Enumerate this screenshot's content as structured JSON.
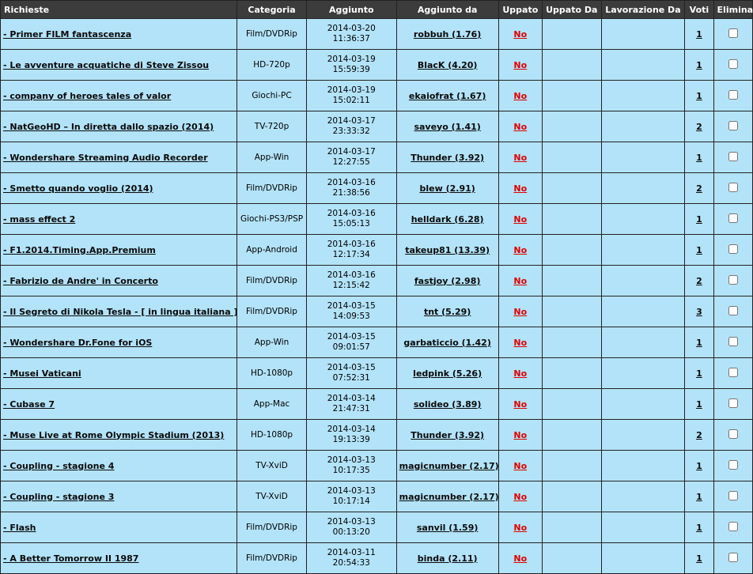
{
  "headers": [
    "Richieste",
    "Categoria",
    "Aggiunto",
    "Aggiunto da",
    "Uppato",
    "Uppato Da",
    "Lavorazione Da",
    "Voti",
    "Elimina"
  ],
  "rows": [
    {
      "title": "- Primer FILM fantascenza",
      "category": "Film/DVDRip",
      "date": "2014-03-20",
      "time": "11:36:37",
      "user": "robbuh (1.76)",
      "uppato": "No",
      "votes": "1"
    },
    {
      "title": "- Le avventure acquatiche di Steve Zissou",
      "category": "HD-720p",
      "date": "2014-03-19",
      "time": "15:59:39",
      "user": "BlacK (4.20)",
      "uppato": "No",
      "votes": "1"
    },
    {
      "title": "- company of heroes tales of valor",
      "category": "Giochi-PC",
      "date": "2014-03-19",
      "time": "15:02:11",
      "user": "ekaiofrat (1.67)",
      "uppato": "No",
      "votes": "1"
    },
    {
      "title": "- NatGeoHD – In diretta dallo spazio (2014)",
      "category": "TV-720p",
      "date": "2014-03-17",
      "time": "23:33:32",
      "user": "saveyo (1.41)",
      "uppato": "No",
      "votes": "2"
    },
    {
      "title": "- Wondershare Streaming Audio Recorder",
      "category": "App-Win",
      "date": "2014-03-17",
      "time": "12:27:55",
      "user": "Thunder (3.92)",
      "uppato": "No",
      "votes": "1"
    },
    {
      "title": "- Smetto quando voglio (2014)",
      "category": "Film/DVDRip",
      "date": "2014-03-16",
      "time": "21:38:56",
      "user": "blew (2.91)",
      "uppato": "No",
      "votes": "2"
    },
    {
      "title": "- mass effect 2",
      "category": "Giochi-PS3/PSP",
      "date": "2014-03-16",
      "time": "15:05:13",
      "user": "helldark (6.28)",
      "uppato": "No",
      "votes": "1"
    },
    {
      "title": "- F1.2014.Timing.App.Premium",
      "category": "App-Android",
      "date": "2014-03-16",
      "time": "12:17:34",
      "user": "takeup81 (13.39)",
      "uppato": "No",
      "votes": "1"
    },
    {
      "title": "- Fabrizio de Andre' in Concerto",
      "category": "Film/DVDRip",
      "date": "2014-03-16",
      "time": "12:15:42",
      "user": "fastjoy (2.98)",
      "uppato": "No",
      "votes": "2"
    },
    {
      "title": "- Il Segreto di Nikola Tesla - [ in lingua italiana ]",
      "category": "Film/DVDRip",
      "date": "2014-03-15",
      "time": "14:09:53",
      "user": "tnt (5.29)",
      "uppato": "No",
      "votes": "3"
    },
    {
      "title": "- Wondershare Dr.Fone for iOS",
      "category": "App-Win",
      "date": "2014-03-15",
      "time": "09:01:57",
      "user": "garbaticcio (1.42)",
      "uppato": "No",
      "votes": "1"
    },
    {
      "title": "- Musei Vaticani",
      "category": "HD-1080p",
      "date": "2014-03-15",
      "time": "07:52:31",
      "user": "ledpink (5.26)",
      "uppato": "No",
      "votes": "1"
    },
    {
      "title": "- Cubase 7",
      "category": "App-Mac",
      "date": "2014-03-14",
      "time": "21:47:31",
      "user": "solideo (3.89)",
      "uppato": "No",
      "votes": "1"
    },
    {
      "title": "- Muse Live at Rome Olympic Stadium (2013)",
      "category": "HD-1080p",
      "date": "2014-03-14",
      "time": "19:13:39",
      "user": "Thunder (3.92)",
      "uppato": "No",
      "votes": "2"
    },
    {
      "title": "- Coupling - stagione 4",
      "category": "TV-XviD",
      "date": "2014-03-13",
      "time": "10:17:35",
      "user": "magicnumber (2.17)",
      "uppato": "No",
      "votes": "1"
    },
    {
      "title": "- Coupling - stagione 3",
      "category": "TV-XviD",
      "date": "2014-03-13",
      "time": "10:17:14",
      "user": "magicnumber (2.17)",
      "uppato": "No",
      "votes": "1"
    },
    {
      "title": "- Flash",
      "category": "Film/DVDRip",
      "date": "2014-03-13",
      "time": "00:13:20",
      "user": "sanvil (1.59)",
      "uppato": "No",
      "votes": "1"
    },
    {
      "title": "- A Better Tomorrow II 1987",
      "category": "Film/DVDRip",
      "date": "2014-03-11",
      "time": "20:54:33",
      "user": "binda (2.11)",
      "uppato": "No",
      "votes": "1"
    }
  ]
}
